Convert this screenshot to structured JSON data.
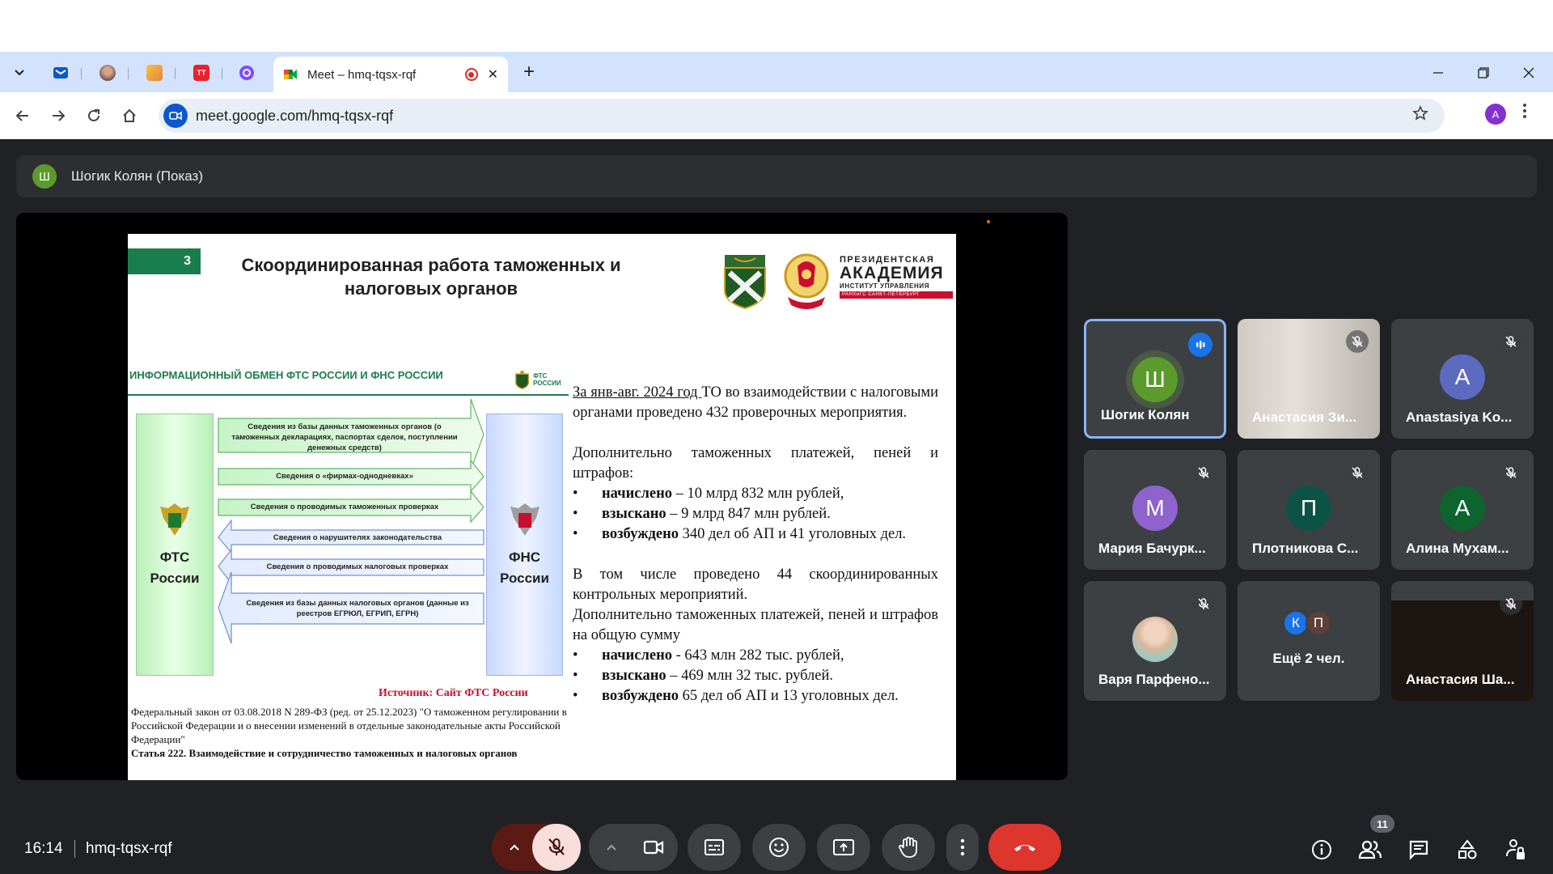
{
  "browser": {
    "active_tab_title": "Meet – hmq-tqsx-rqf",
    "url": "meet.google.com/hmq-tqsx-rqf",
    "profile_initial": "A",
    "pinned_tabs": [
      "mail-icon",
      "avatar-tab-icon",
      "channel-tab-icon",
      "tt-tab-icon",
      "purple-tab-icon"
    ],
    "pinned_tt": "TT"
  },
  "meet": {
    "presenter_initial": "Ш",
    "presenter_label": "Шогик Колян (Показ)",
    "time": "16:14",
    "meeting_code": "hmq-tqsx-rqf",
    "participant_count": "11"
  },
  "slide": {
    "number": "3",
    "title": "Скоординированная работа таможенных и налоговых органов",
    "ranepa": {
      "line1": "ПРЕЗИДЕНТСКАЯ",
      "line2": "АКАДЕМИЯ",
      "line3": "ИНСТИТУТ УПРАВЛЕНИЯ",
      "line4": "РАНХиГС САНКТ-ПЕТЕРБУРГ"
    },
    "diagram": {
      "heading": "ИНФОРМАЦИОННЫЙ ОБМЕН ФТС РОССИИ И ФНС РОССИИ",
      "logo_text": "ФТС РОССИИ",
      "left_label": "ФТС России",
      "right_label": "ФНС России",
      "arrows": [
        "Сведения из базы данных таможенных органов (о таможенных декларациях, паспортах сделок, поступлении денежных средств)",
        "Сведения о «фирмах-однодневках»",
        "Сведения о проводимых таможенных проверках",
        "Сведения о нарушителях законодательства",
        "Сведения о проводимых налоговых проверках",
        "Сведения из базы данных налоговых органов (данные из реестров ЕГРЮЛ, ЕГРИП, ЕГРН)"
      ],
      "source": "Источник: Сайт ФТС России"
    },
    "law_text": "Федеральный закон от 03.08.2018 N 289-ФЗ (ред. от 25.12.2023) \"О таможенном регулировании в Российской Федерации и о внесении изменений в отдельные законодательные акты Российской Федерации\"",
    "law_article": "Статья 222. Взаимодействие и сотрудничество таможенных и налоговых органов",
    "para1_u": "За янв-авг. 2024 год ",
    "para1_rest": "ТО во взаимодействии с налоговыми органами проведено 432 проверочных мероприятия.",
    "para2": "Дополнительно таможенных платежей, пеней и штрафов:",
    "list1": [
      {
        "b": "начислено",
        "t": " – 10 млрд 832 млн рублей,"
      },
      {
        "b": "взыскано",
        "t": " – 9 млрд 847 млн рублей."
      },
      {
        "b": "возбуждено",
        "t": " 340 дел об АП и 41 уголовных дел."
      }
    ],
    "para3": "В том числе проведено 44 скоординированных контрольных мероприятий.",
    "para4": "Дополнительно таможенных платежей, пеней и штрафов на общую сумму",
    "list2": [
      {
        "b": "начислено",
        "t": " - 643 млн 282 тыс. рублей,"
      },
      {
        "b": "взыскано",
        "t": " – 469 млн 32 тыс. рублей."
      },
      {
        "b": "возбуждено",
        "t": " 65 дел об АП и 13 уголовных дел."
      }
    ]
  },
  "participants": [
    {
      "name": "Шогик Колян",
      "initial": "Ш",
      "color": "#5c9b2b",
      "speaking": true
    },
    {
      "name": "Анастасия Зи...",
      "initial": "",
      "color": "",
      "video": true
    },
    {
      "name": "Anastasiya Ko...",
      "initial": "A",
      "color": "#5c6bc0"
    },
    {
      "name": "Мария Бачурк...",
      "initial": "М",
      "color": "#8e63ce"
    },
    {
      "name": "Плотникова С...",
      "initial": "П",
      "color": "#0b5345"
    },
    {
      "name": "Алина Мухам...",
      "initial": "А",
      "color": "#0d652d"
    },
    {
      "name": "Варя Парфено...",
      "initial": "",
      "color": "",
      "photo": true
    },
    {
      "name": "Ещё 2 чел.",
      "more": [
        "К",
        "П"
      ],
      "more_colors": [
        "#1a73e8",
        "#5d4037"
      ]
    },
    {
      "name": "Анастасия Ша...",
      "initial": "",
      "color": "",
      "dark": true
    }
  ]
}
